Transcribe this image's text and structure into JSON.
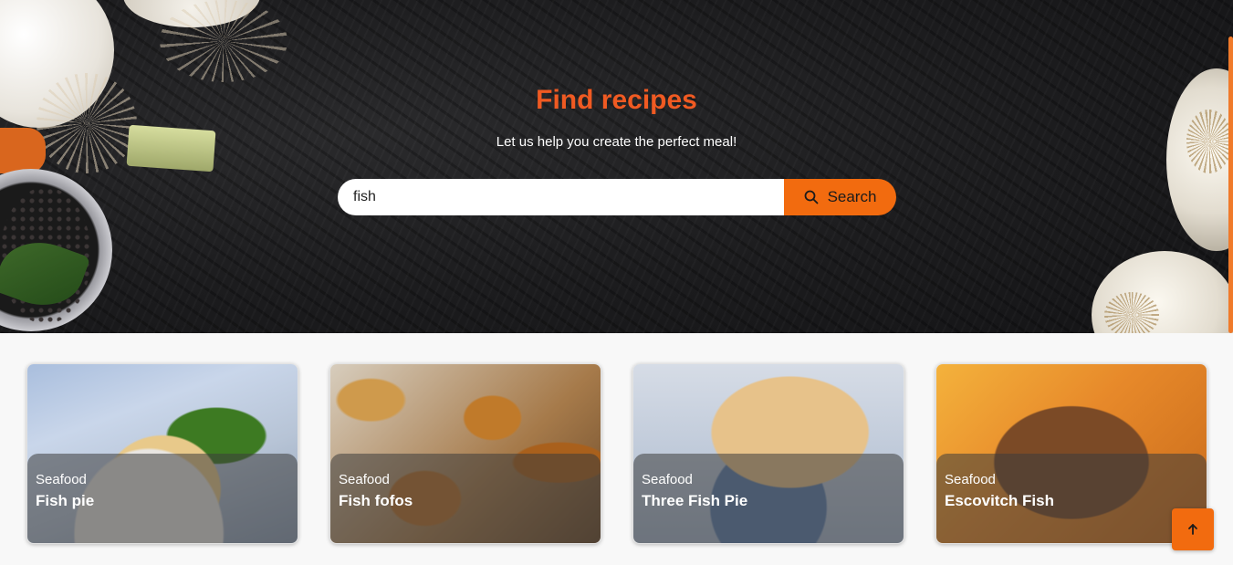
{
  "hero": {
    "title": "Find recipes",
    "subtitle": "Let us help you create the perfect meal!",
    "search": {
      "value": "fish",
      "button_label": "Search",
      "icon": "search-icon"
    }
  },
  "colors": {
    "accent": "#f26b0f",
    "title": "#f05a22"
  },
  "recipes": [
    {
      "category": "Seafood",
      "name": "Fish pie"
    },
    {
      "category": "Seafood",
      "name": "Fish fofos"
    },
    {
      "category": "Seafood",
      "name": "Three Fish Pie"
    },
    {
      "category": "Seafood",
      "name": "Escovitch Fish"
    }
  ],
  "scroll_top": {
    "icon": "arrow-up-icon"
  }
}
